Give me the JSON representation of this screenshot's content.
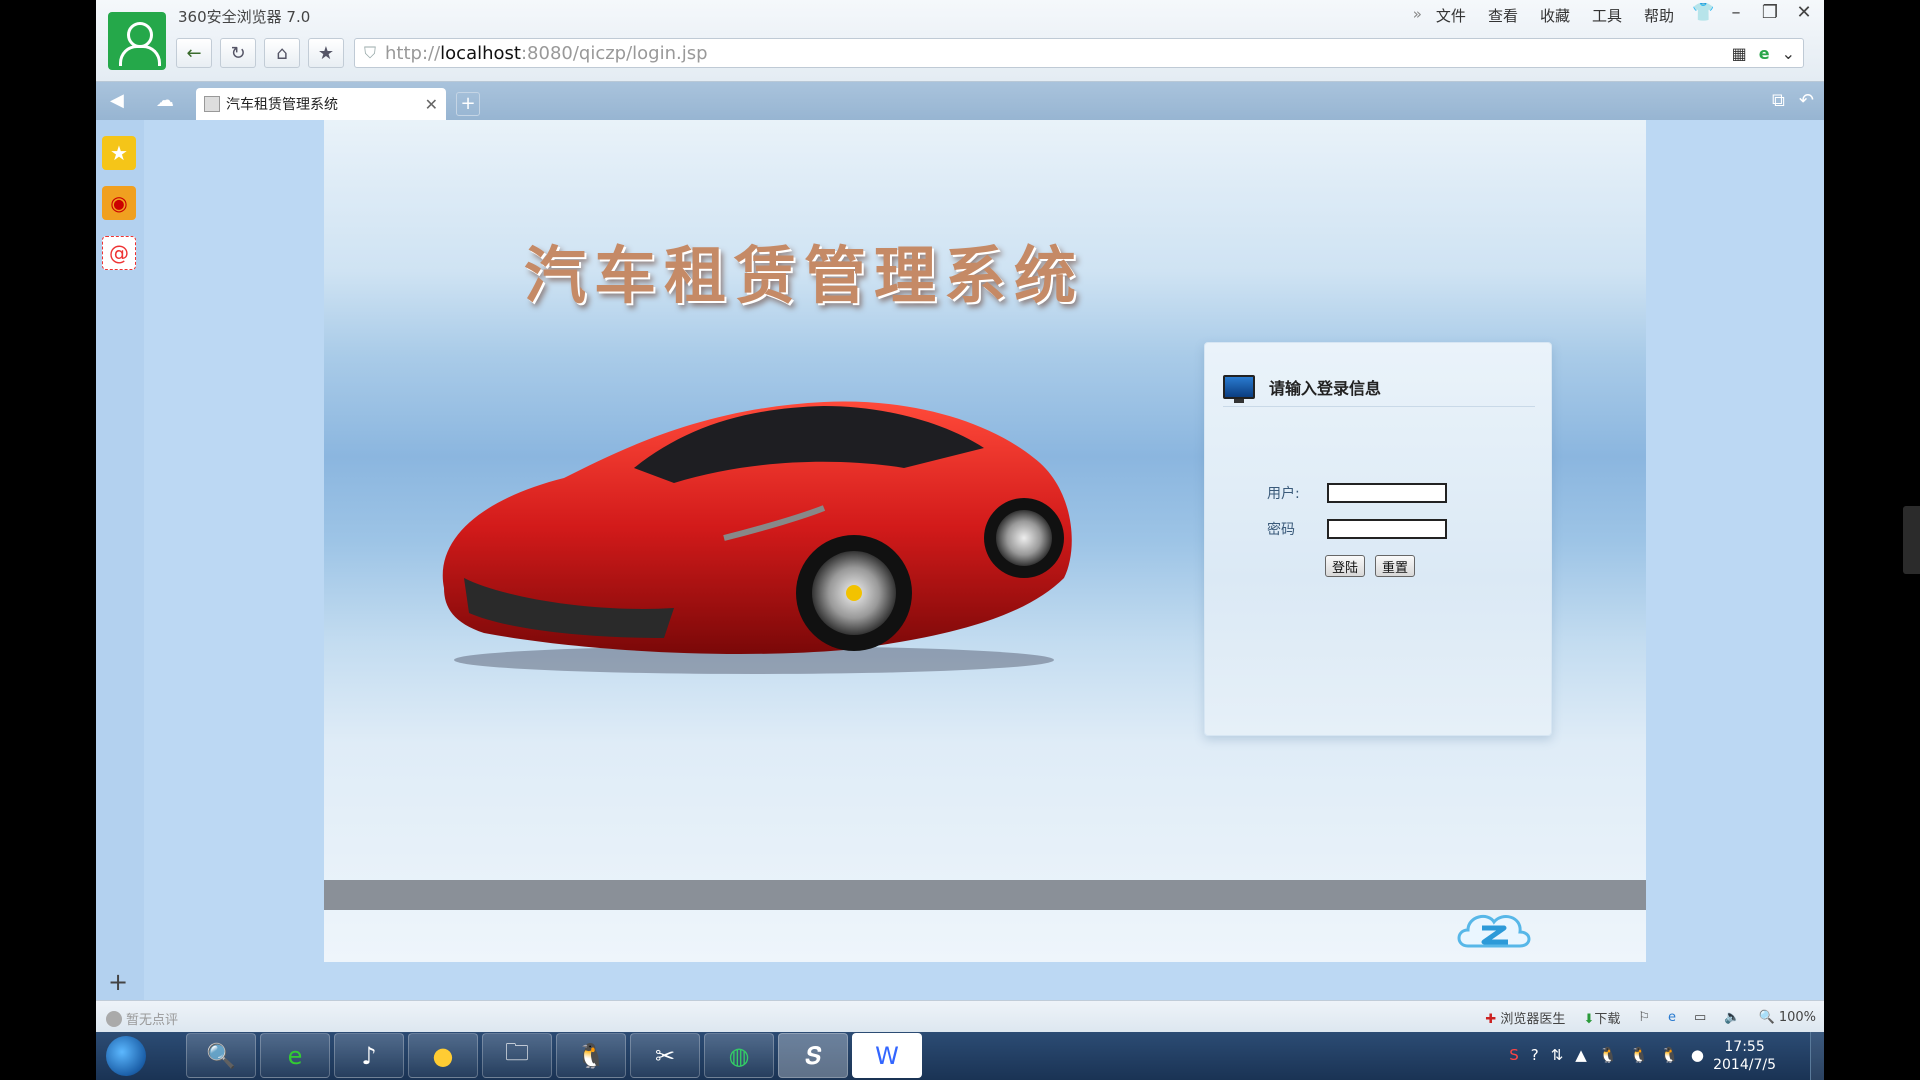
{
  "browser": {
    "app_title": "360安全浏览器 7.0",
    "menu": [
      "文件",
      "查看",
      "收藏",
      "工具",
      "帮助"
    ],
    "url_scheme": "http://",
    "url_host": "localhost",
    "url_rest": ":8080/qiczp/login.jsp",
    "tab_title": "汽车租赁管理系统"
  },
  "page": {
    "title": "汽车租赁管理系统",
    "login": {
      "heading": "请输入登录信息",
      "user_label": "用户:",
      "password_label": "密码",
      "user_value": "",
      "password_value": "",
      "login_button": "登陆",
      "reset_button": "重置"
    }
  },
  "statusbar": {
    "left_text": "暂无点评",
    "doctor": "浏览器医生",
    "download": "下载",
    "zoom": "100%"
  },
  "taskbar": {
    "time": "17:55",
    "date": "2014/7/5"
  },
  "colors": {
    "title_text": "#c58a66",
    "car_body": "#d21a1a",
    "footer_bar": "#8a9098",
    "avatar": "#25a84a"
  }
}
